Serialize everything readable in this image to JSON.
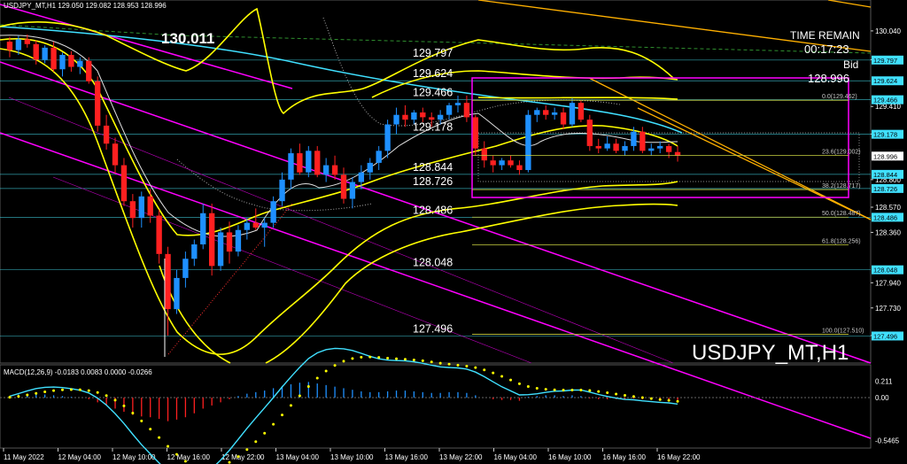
{
  "header": {
    "symbol_line": "USDJPY_MT,H1  129.050 129.082 128.953 128.996",
    "high_label": "130.011",
    "time_remain_label": "TIME REMAIN",
    "time_remain_value": "00:17:23",
    "bid_label": "Bid",
    "bid_value": "128.996",
    "watermark": "USDJPY_MT,H1"
  },
  "macd": {
    "header": "MACD(12,26,9) -0.0183 0.0083 0.0000 -0.0266",
    "ticks": [
      "0.211",
      "0.00",
      "-0.5465"
    ],
    "range": [
      -0.62,
      0.26
    ]
  },
  "colors": {
    "bull": "#1e90ff",
    "bear": "#ff2020",
    "bollinger": "#ffff00",
    "trendline": "#ff00ff",
    "orange_line": "#ffb000",
    "cyan_ma": "#40e0ff",
    "white_ma": "#ffffff",
    "fib": "#ffff40",
    "grid": "#2a2a2a"
  },
  "chart_data": {
    "type": "candlestick",
    "title": "USDJPY_MT,H1",
    "ylim": [
      127.3,
      130.15
    ],
    "price_ticks": [
      "130.040",
      "129.800",
      "129.410",
      "129.180",
      "128.800",
      "128.570",
      "128.360",
      "127.940",
      "127.730",
      "127.500"
    ],
    "time_labels": [
      "11 May 2022",
      "12 May 04:00",
      "12 May 10:00",
      "12 May 16:00",
      "12 May 22:00",
      "13 May 04:00",
      "13 May 10:00",
      "13 May 16:00",
      "13 May 22:00",
      "16 May 04:00",
      "16 May 10:00",
      "16 May 16:00",
      "16 May 22:00"
    ],
    "levels": [
      {
        "value": 129.797,
        "label": "129.797",
        "tag_color": "#40e0ff"
      },
      {
        "value": 129.624,
        "label": "129.624",
        "tag_color": "#40e0ff"
      },
      {
        "value": 129.466,
        "label": "129.466",
        "tag_color": "#40e0ff"
      },
      {
        "value": 129.178,
        "label": "129.178",
        "tag_color": "#40e0ff"
      },
      {
        "value": 128.996,
        "label": "128.996",
        "tag_color": "#ffffff",
        "current": true
      },
      {
        "value": 128.844,
        "label": "128.844",
        "tag_color": "#40e0ff"
      },
      {
        "value": 128.726,
        "label": "128.726",
        "tag_color": "#40e0ff"
      },
      {
        "value": 128.486,
        "label": "128.486",
        "tag_color": "#40e0ff"
      },
      {
        "value": 128.048,
        "label": "128.048",
        "tag_color": "#40e0ff"
      },
      {
        "value": 127.496,
        "label": "127.496",
        "tag_color": "#40e0ff"
      }
    ],
    "fib_labels": [
      {
        "value": 129.462,
        "label": "0.0(129.462)"
      },
      {
        "value": 129.002,
        "label": "23.6(129.002)"
      },
      {
        "value": 128.717,
        "label": "38.2(128.717)"
      },
      {
        "value": 128.487,
        "label": "50.0(128.487)"
      },
      {
        "value": 128.256,
        "label": "61.8(128.256)"
      },
      {
        "value": 127.51,
        "label": "100.0(127.510)"
      }
    ],
    "ohlc": [
      [
        129.95,
        129.99,
        129.82,
        129.88
      ],
      [
        129.88,
        130.0,
        129.84,
        129.97
      ],
      [
        129.97,
        130.01,
        129.9,
        129.93
      ],
      [
        129.93,
        129.96,
        129.76,
        129.8
      ],
      [
        129.8,
        129.92,
        129.77,
        129.9
      ],
      [
        129.9,
        129.95,
        129.7,
        129.72
      ],
      [
        129.72,
        129.86,
        129.66,
        129.84
      ],
      [
        129.84,
        129.87,
        129.7,
        129.74
      ],
      [
        129.74,
        129.82,
        129.68,
        129.79
      ],
      [
        129.79,
        129.82,
        129.6,
        129.62
      ],
      [
        129.62,
        129.66,
        129.2,
        129.25
      ],
      [
        129.25,
        129.34,
        129.05,
        129.1
      ],
      [
        129.1,
        129.15,
        128.85,
        128.92
      ],
      [
        128.92,
        128.98,
        128.58,
        128.62
      ],
      [
        128.62,
        128.68,
        128.4,
        128.48
      ],
      [
        128.48,
        128.7,
        128.4,
        128.66
      ],
      [
        128.66,
        128.72,
        128.44,
        128.5
      ],
      [
        128.5,
        128.55,
        128.1,
        128.18
      ],
      [
        128.18,
        128.24,
        127.5,
        127.72
      ],
      [
        127.72,
        128.05,
        127.68,
        127.98
      ],
      [
        127.98,
        128.2,
        127.9,
        128.14
      ],
      [
        128.14,
        128.3,
        128.08,
        128.26
      ],
      [
        128.26,
        128.6,
        128.22,
        128.52
      ],
      [
        128.52,
        128.6,
        128.0,
        128.08
      ],
      [
        128.08,
        128.4,
        128.04,
        128.36
      ],
      [
        128.36,
        128.45,
        128.1,
        128.2
      ],
      [
        128.2,
        128.42,
        128.16,
        128.38
      ],
      [
        128.38,
        128.48,
        128.3,
        128.44
      ],
      [
        128.44,
        128.56,
        128.38,
        128.4
      ],
      [
        128.4,
        128.48,
        128.24,
        128.44
      ],
      [
        128.44,
        128.66,
        128.4,
        128.62
      ],
      [
        128.62,
        128.86,
        128.58,
        128.8
      ],
      [
        128.8,
        129.06,
        128.72,
        129.02
      ],
      [
        129.02,
        129.1,
        128.84,
        128.86
      ],
      [
        128.86,
        129.08,
        128.82,
        129.04
      ],
      [
        129.04,
        129.08,
        128.82,
        128.84
      ],
      [
        128.84,
        128.98,
        128.78,
        128.92
      ],
      [
        128.92,
        129.0,
        128.8,
        128.84
      ],
      [
        128.84,
        128.9,
        128.6,
        128.64
      ],
      [
        128.64,
        128.82,
        128.56,
        128.78
      ],
      [
        128.78,
        128.92,
        128.72,
        128.86
      ],
      [
        128.86,
        128.98,
        128.8,
        128.94
      ],
      [
        128.94,
        129.08,
        128.88,
        129.04
      ],
      [
        129.04,
        129.3,
        128.98,
        129.26
      ],
      [
        129.26,
        129.4,
        129.18,
        129.34
      ],
      [
        129.34,
        129.42,
        129.24,
        129.3
      ],
      [
        129.3,
        129.38,
        129.26,
        129.36
      ],
      [
        129.36,
        129.4,
        129.28,
        129.32
      ],
      [
        129.32,
        129.36,
        129.24,
        129.3
      ],
      [
        129.3,
        129.38,
        129.26,
        129.34
      ],
      [
        129.34,
        129.44,
        129.3,
        129.42
      ],
      [
        129.42,
        129.5,
        129.36,
        129.44
      ],
      [
        129.44,
        129.5,
        129.28,
        129.32
      ],
      [
        129.32,
        129.34,
        129.0,
        129.06
      ],
      [
        129.06,
        129.12,
        128.9,
        128.96
      ],
      [
        128.96,
        129.0,
        128.86,
        128.92
      ],
      [
        128.92,
        128.98,
        128.88,
        128.96
      ],
      [
        128.96,
        129.0,
        128.9,
        128.92
      ],
      [
        128.92,
        128.96,
        128.84,
        128.88
      ],
      [
        128.88,
        129.38,
        128.86,
        129.34
      ],
      [
        129.34,
        129.4,
        129.28,
        129.38
      ],
      [
        129.38,
        129.42,
        129.3,
        129.34
      ],
      [
        129.34,
        129.4,
        129.3,
        129.36
      ],
      [
        129.36,
        129.4,
        129.22,
        129.26
      ],
      [
        129.26,
        129.48,
        129.24,
        129.44
      ],
      [
        129.44,
        129.46,
        129.28,
        129.3
      ],
      [
        129.3,
        129.34,
        129.04,
        129.08
      ],
      [
        129.08,
        129.14,
        129.02,
        129.06
      ],
      [
        129.06,
        129.16,
        129.04,
        129.1
      ],
      [
        129.1,
        129.14,
        129.02,
        129.04
      ],
      [
        129.04,
        129.12,
        129.0,
        129.08
      ],
      [
        129.08,
        129.24,
        129.04,
        129.2
      ],
      [
        129.2,
        129.24,
        129.02,
        129.04
      ],
      [
        129.04,
        129.1,
        129.0,
        129.06
      ],
      [
        129.06,
        129.12,
        129.02,
        129.08
      ],
      [
        129.08,
        129.1,
        128.98,
        129.03
      ],
      [
        129.03,
        129.08,
        128.95,
        129.0
      ]
    ],
    "macd_hist": [
      0.02,
      0.04,
      0.05,
      0.05,
      0.04,
      0.03,
      0.02,
      0.01,
      0.0,
      -0.02,
      -0.06,
      -0.1,
      -0.14,
      -0.18,
      -0.22,
      -0.24,
      -0.25,
      -0.27,
      -0.3,
      -0.28,
      -0.25,
      -0.2,
      -0.14,
      -0.1,
      -0.06,
      -0.02,
      0.02,
      0.05,
      0.07,
      0.09,
      0.12,
      0.15,
      0.17,
      0.19,
      0.2,
      0.18,
      0.16,
      0.14,
      0.12,
      0.1,
      0.08,
      0.07,
      0.07,
      0.08,
      0.09,
      0.09,
      0.08,
      0.07,
      0.06,
      0.06,
      0.07,
      0.07,
      0.06,
      0.03,
      0.0,
      -0.02,
      -0.03,
      -0.03,
      -0.04,
      0.01,
      0.02,
      0.03,
      0.03,
      0.02,
      0.03,
      0.02,
      -0.01,
      -0.02,
      -0.02,
      -0.02,
      -0.02,
      -0.01,
      -0.02,
      -0.02,
      -0.02,
      -0.02,
      -0.03
    ]
  }
}
